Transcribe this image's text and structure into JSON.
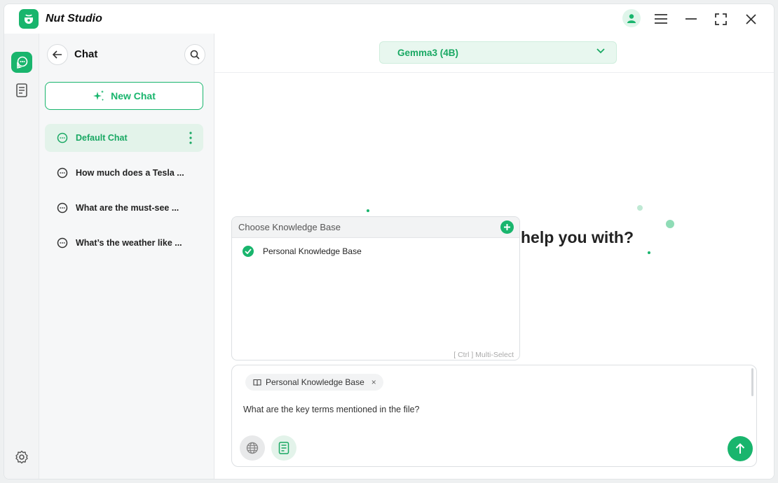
{
  "app": {
    "title": "Nut Studio"
  },
  "titlebar": {
    "icons": [
      "user-icon",
      "menu-icon",
      "minimize-icon",
      "maximize-icon",
      "close-icon"
    ]
  },
  "rail": {
    "items": [
      "chat-icon",
      "knowledge-base-icon"
    ],
    "footer": "settings-icon"
  },
  "sidebar": {
    "title": "Chat",
    "new_chat_label": "New Chat",
    "chats": [
      {
        "label": "Default Chat",
        "active": true
      },
      {
        "label": "How much does a Tesla ...",
        "active": false
      },
      {
        "label": "What are the must-see ...",
        "active": false
      },
      {
        "label": "What’s the weather like ...",
        "active": false
      }
    ]
  },
  "main": {
    "model": "Gemma3 (4B)",
    "welcome_text": "help you with?"
  },
  "knowledge_popup": {
    "header": "Choose Knowledge Base",
    "items": [
      {
        "label": "Personal Knowledge Base",
        "selected": true
      }
    ],
    "hint": "[ Ctrl ] Multi-Select"
  },
  "input": {
    "chip_label": "Personal Knowledge Base",
    "chip_remove": "×",
    "message": "What are the key terms mentioned in the file?"
  },
  "colors": {
    "accent": "#19b56d",
    "accent_light": "#e3f3ea"
  }
}
